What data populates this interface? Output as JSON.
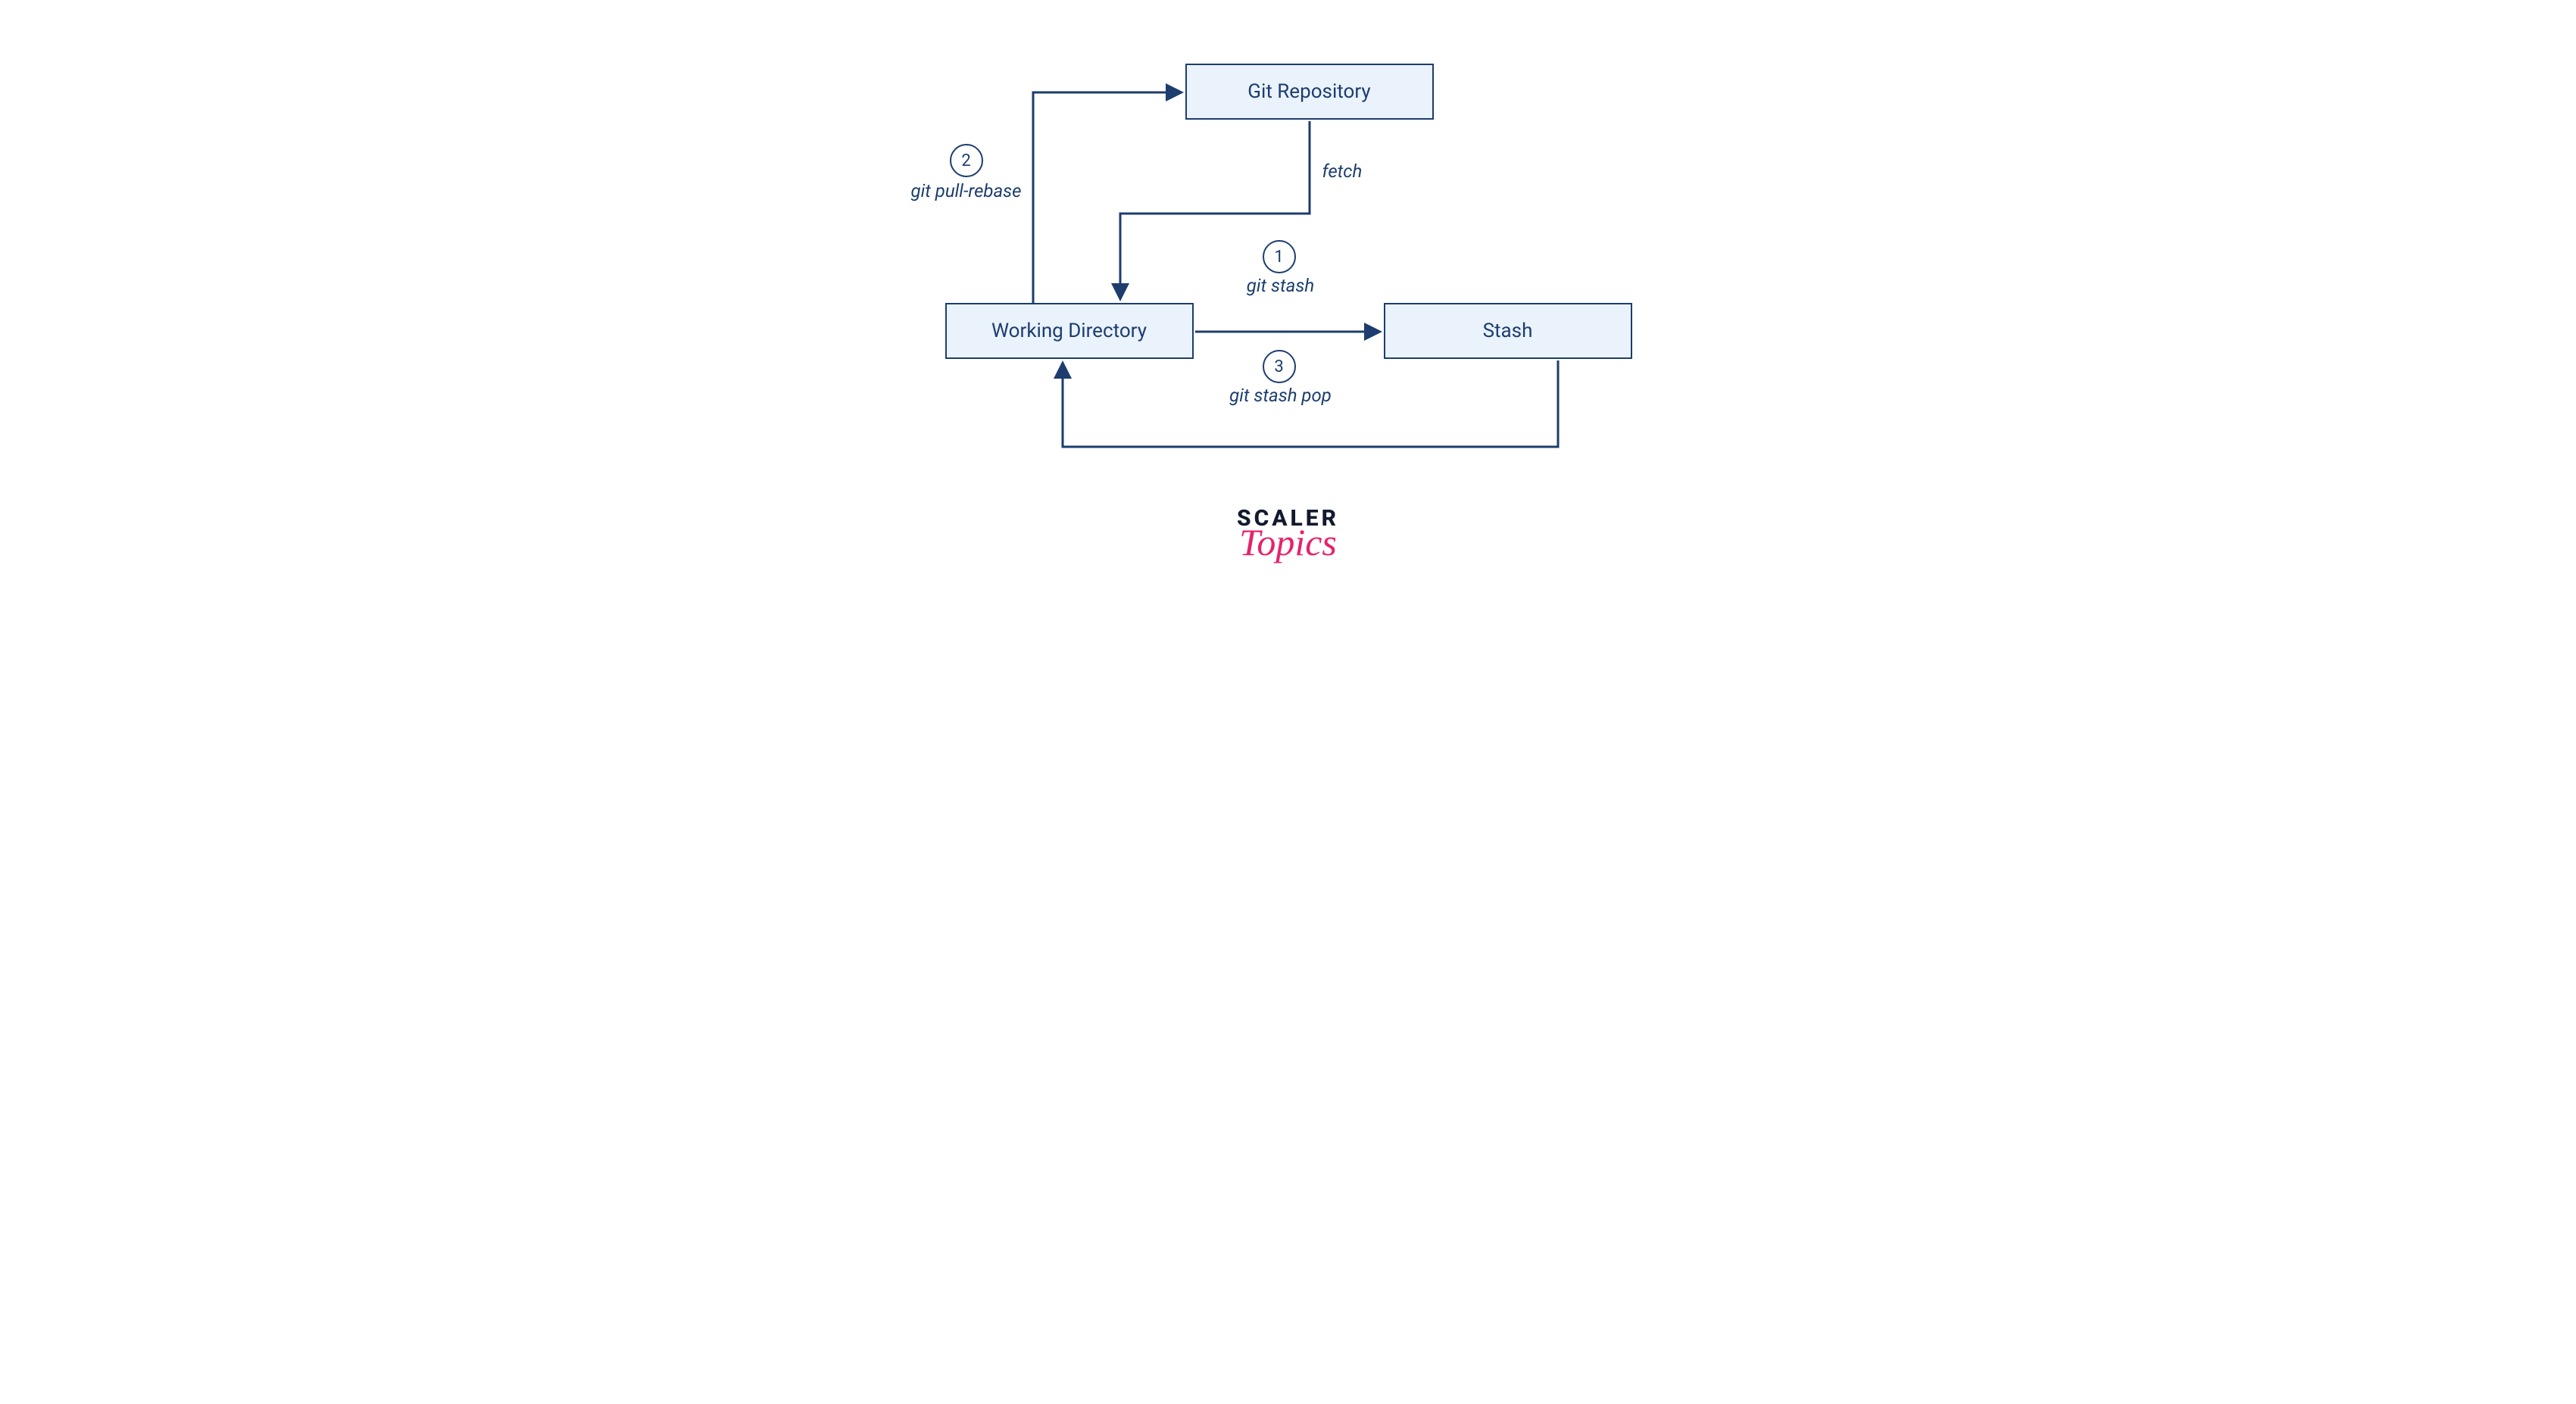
{
  "colors": {
    "stroke": "#1c3d6e",
    "nodeFill": "#eaf2fb",
    "accent": "#e6226d",
    "logoDark": "#131a2e"
  },
  "nodes": {
    "repo": {
      "label": "Git Repository"
    },
    "workdir": {
      "label": "Working Directory"
    },
    "stash": {
      "label": "Stash"
    }
  },
  "edges": {
    "fetch": {
      "label": "fetch"
    },
    "pullRebase": {
      "label": "git pull-rebase",
      "step": "2"
    },
    "stash": {
      "label": "git stash",
      "step": "1"
    },
    "stashPop": {
      "label": "git stash pop",
      "step": "3"
    }
  },
  "logo": {
    "line1": "SCALER",
    "line2": "Topics"
  }
}
